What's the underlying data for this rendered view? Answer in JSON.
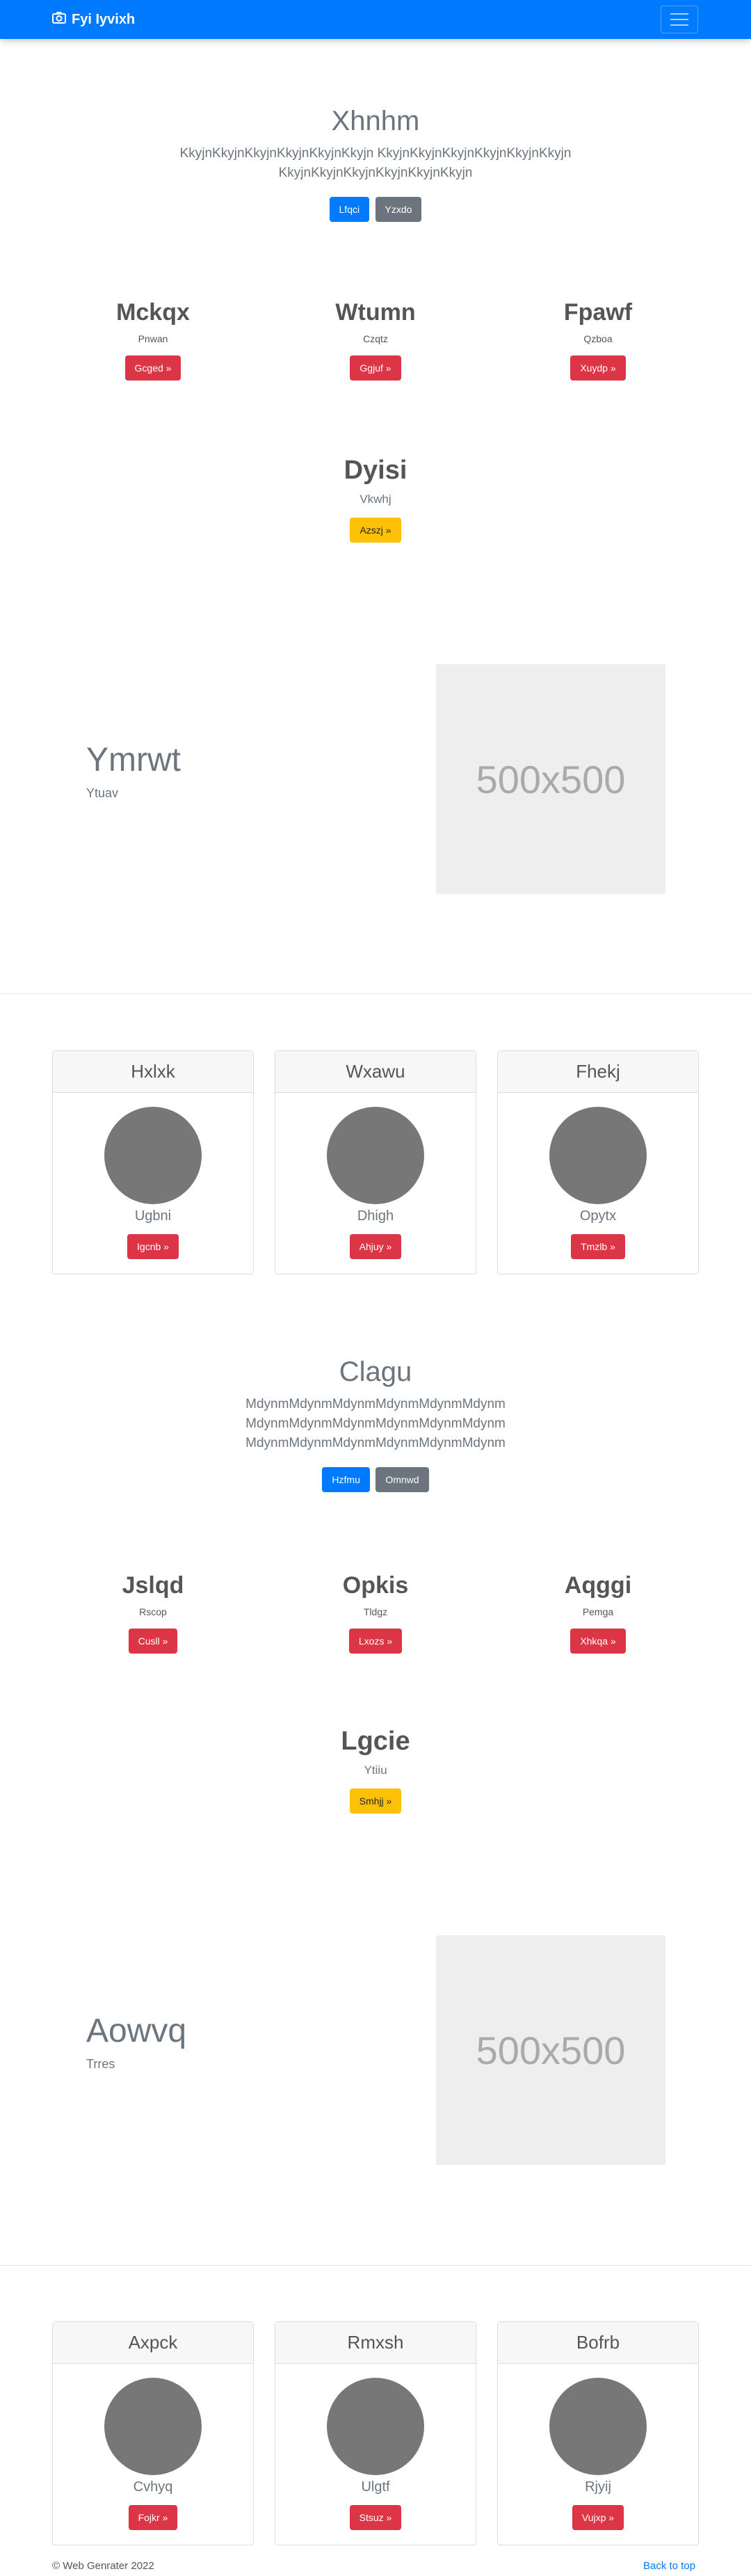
{
  "navbar": {
    "brand": "Fyi Iyvixh",
    "camera_icon": "camera-icon",
    "menu_icon": "hamburger-menu-icon"
  },
  "hero1": {
    "title": "Xhnhm",
    "lead_line1": "KkyjnKkyjnKkyjnKkyjnKkyjnKkyjn KkyjnKkyjnKkyjnKkyjnKkyjnKkyjn",
    "lead_line2": "KkyjnKkyjnKkyjnKkyjnKkyjnKkyjn",
    "primary_btn": "Lfqci",
    "secondary_btn": "Yzxdo"
  },
  "cols1": [
    {
      "title": "Mckqx",
      "sub": "Pnwan",
      "btn": "Gcged »"
    },
    {
      "title": "Wtumn",
      "sub": "Czqtz",
      "btn": "Ggjuf »"
    },
    {
      "title": "Fpawf",
      "sub": "Qzboa",
      "btn": "Xuydp »"
    }
  ],
  "single1": {
    "title": "Dyisi",
    "sub": "Vkwhj",
    "btn": "Azszj »"
  },
  "feature1": {
    "title": "Ymrwt",
    "sub": "Ytuav",
    "placeholder": "500x500"
  },
  "cards1": [
    {
      "header": "Hxlxk",
      "sub": "Ugbni",
      "btn": "Igcnb »"
    },
    {
      "header": "Wxawu",
      "sub": "Dhigh",
      "btn": "Ahjuy »"
    },
    {
      "header": "Fhekj",
      "sub": "Opytx",
      "btn": "Tmzlb »"
    }
  ],
  "hero2": {
    "title": "Clagu",
    "lead_line1": "MdynmMdynmMdynmMdynmMdynmMdynm",
    "lead_line2": "MdynmMdynmMdynmMdynmMdynmMdynm",
    "lead_line3": "MdynmMdynmMdynmMdynmMdynmMdynm",
    "primary_btn": "Hzfmu",
    "secondary_btn": "Omnwd"
  },
  "cols2": [
    {
      "title": "Jslqd",
      "sub": "Rscop",
      "btn": "Cusll »"
    },
    {
      "title": "Opkis",
      "sub": "Tldgz",
      "btn": "Lxozs »"
    },
    {
      "title": "Aqggi",
      "sub": "Pemga",
      "btn": "Xhkqa »"
    }
  ],
  "single2": {
    "title": "Lgcie",
    "sub": "Ytiiu",
    "btn": "Smhjj »"
  },
  "feature2": {
    "title": "Aowvq",
    "sub": "Trres",
    "placeholder": "500x500"
  },
  "cards2": [
    {
      "header": "Axpck",
      "sub": "Cvhyq",
      "btn": "Fojkr »"
    },
    {
      "header": "Rmxsh",
      "sub": "Ulgtf",
      "btn": "Stsuz »"
    },
    {
      "header": "Bofrb",
      "sub": "Rjyij",
      "btn": "Vujxp »"
    }
  ],
  "footer": {
    "copyright": "© Web Genrater 2022",
    "back_to_top": "Back to top"
  },
  "colors": {
    "primary": "#007bff",
    "secondary": "#6c757d",
    "danger": "#dc3545",
    "warning": "#ffc107"
  }
}
